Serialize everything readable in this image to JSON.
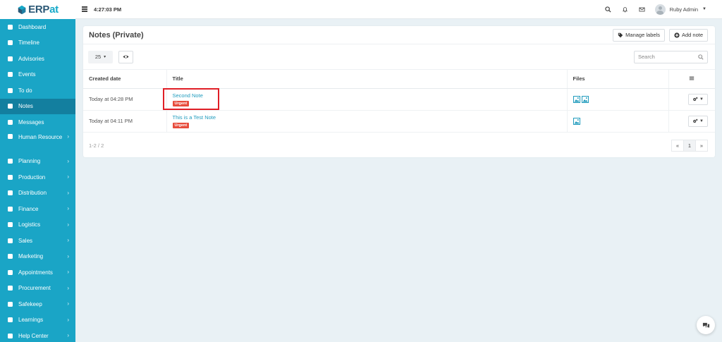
{
  "app": {
    "logo_text": "ERPat",
    "logo_accent": "#15a9c9",
    "sidebar_color": "#1aa5c6",
    "active_color": "#137f9f"
  },
  "topbar": {
    "time": "4:27:03 PM",
    "user_name": "Ruby Admin"
  },
  "sidebar": {
    "items": [
      {
        "label": "Dashboard",
        "icon": "dashboard-icon",
        "has_submenu": false
      },
      {
        "label": "Timeline",
        "icon": "timeline-icon",
        "has_submenu": false
      },
      {
        "label": "Advisories",
        "icon": "megaphone-icon",
        "has_submenu": false
      },
      {
        "label": "Events",
        "icon": "calendar-icon",
        "has_submenu": false
      },
      {
        "label": "To do",
        "icon": "checkbox-icon",
        "has_submenu": false
      },
      {
        "label": "Notes",
        "icon": "note-icon",
        "has_submenu": false,
        "active": true
      },
      {
        "label": "Messages",
        "icon": "envelope-icon",
        "has_submenu": false
      },
      {
        "label": "Human Resource",
        "icon": "users-icon",
        "has_submenu": true
      },
      {
        "label": "Planning",
        "icon": "briefcase-icon",
        "has_submenu": true
      },
      {
        "label": "Production",
        "icon": "flask-icon",
        "has_submenu": true
      },
      {
        "label": "Distribution",
        "icon": "bank-icon",
        "has_submenu": true
      },
      {
        "label": "Finance",
        "icon": "money-icon",
        "has_submenu": true
      },
      {
        "label": "Logistics",
        "icon": "truck-icon",
        "has_submenu": true
      },
      {
        "label": "Sales",
        "icon": "cart-icon",
        "has_submenu": true
      },
      {
        "label": "Marketing",
        "icon": "chart-line-icon",
        "has_submenu": true
      },
      {
        "label": "Appointments",
        "icon": "edit-icon",
        "has_submenu": true
      },
      {
        "label": "Procurement",
        "icon": "cubes-icon",
        "has_submenu": true
      },
      {
        "label": "Safekeep",
        "icon": "archive-icon",
        "has_submenu": true
      },
      {
        "label": "Learnings",
        "icon": "graduation-cap-icon",
        "has_submenu": true
      },
      {
        "label": "Help Center",
        "icon": "help-icon",
        "has_submenu": true
      }
    ]
  },
  "page": {
    "title": "Notes (Private)",
    "manage_labels": "Manage labels",
    "add_note": "Add note",
    "page_size": "25",
    "search_placeholder": "Search"
  },
  "table": {
    "headers": {
      "created": "Created date",
      "title": "Title",
      "files": "Files"
    },
    "rows": [
      {
        "created": "Today at 04:28 PM",
        "title": "Second Note",
        "label": "Urgent",
        "files": 2
      },
      {
        "created": "Today at 04:11 PM",
        "title": "This is a Test Note",
        "label": "Urgent",
        "files": 1
      }
    ]
  },
  "footer": {
    "count": "1-2 / 2",
    "prev": "«",
    "page": "1",
    "next": "»"
  }
}
